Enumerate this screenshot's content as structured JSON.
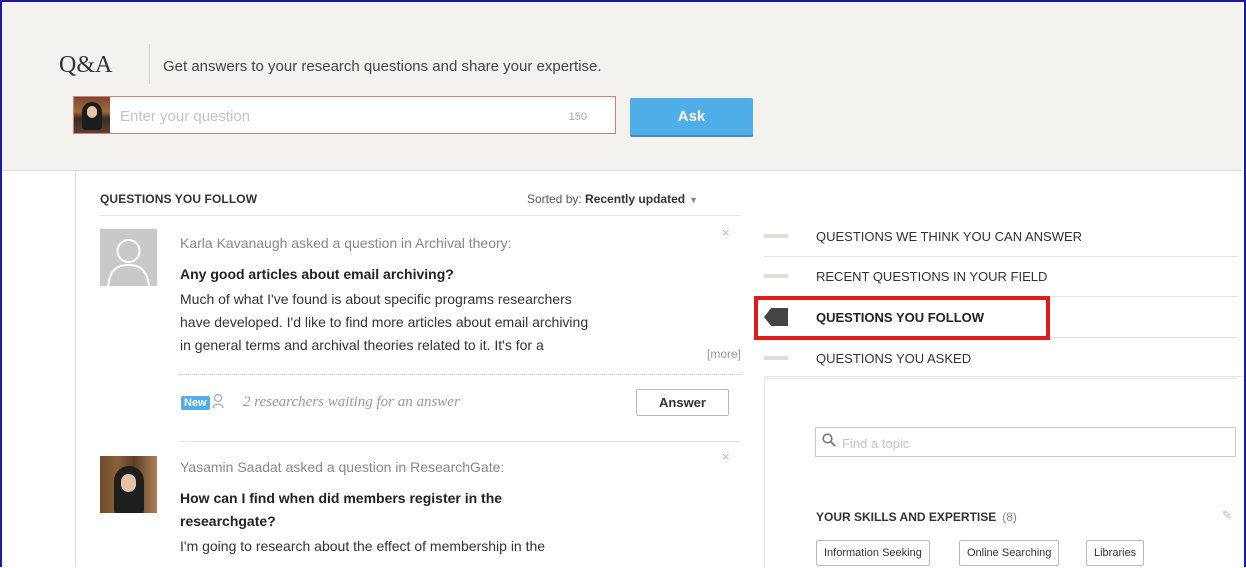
{
  "header": {
    "brand": "Q&A",
    "tagline": "Get answers to your research questions and share your expertise.",
    "ask_placeholder": "Enter your question",
    "char_count": "150",
    "ask_button": "Ask"
  },
  "list": {
    "title": "QUESTIONS YOU FOLLOW",
    "sort_prefix": "Sorted by:",
    "sort_value": "Recently updated",
    "questions": [
      {
        "meta": "Karla Kavanaugh asked a question in Archival theory:",
        "title": "Any good articles about email archiving?",
        "body_lines": [
          "Much of what I've found is about specific programs researchers",
          "have developed. I'd like to find more articles about email archiving",
          "in general terms and archival theories related to it. It's for a"
        ],
        "more": "[more]",
        "badge": "New",
        "waiting": "2 researchers waiting for an answer",
        "answer_button": "Answer",
        "close": "×"
      },
      {
        "meta": "Yasamin Saadat asked a question in ResearchGate:",
        "title_lines": [
          "How can I find when did members register in the",
          "researchgate?"
        ],
        "body_lines": [
          "I'm going to research about the effect of membership in the"
        ],
        "close": "×"
      }
    ]
  },
  "tabs": [
    {
      "label": "QUESTIONS WE THINK YOU CAN ANSWER",
      "active": false
    },
    {
      "label": "RECENT QUESTIONS IN YOUR FIELD",
      "active": false
    },
    {
      "label": "QUESTIONS YOU FOLLOW",
      "active": true
    },
    {
      "label": "QUESTIONS YOU ASKED",
      "active": false
    }
  ],
  "sidebar": {
    "topic_placeholder": "Find a topic",
    "skills_title": "YOUR SKILLS AND EXPERTISE",
    "skills_count": "(8)",
    "skills": [
      "Information Seeking",
      "Online Searching",
      "Libraries"
    ]
  },
  "colors": {
    "accent": "#4faee8",
    "highlight": "#e01b1b",
    "header_bg": "#f3f2ee"
  },
  "icons": [
    "search-icon",
    "close-icon",
    "pencil-icon",
    "followers-icon",
    "chevron-down-icon",
    "active-tab-flag-icon"
  ]
}
